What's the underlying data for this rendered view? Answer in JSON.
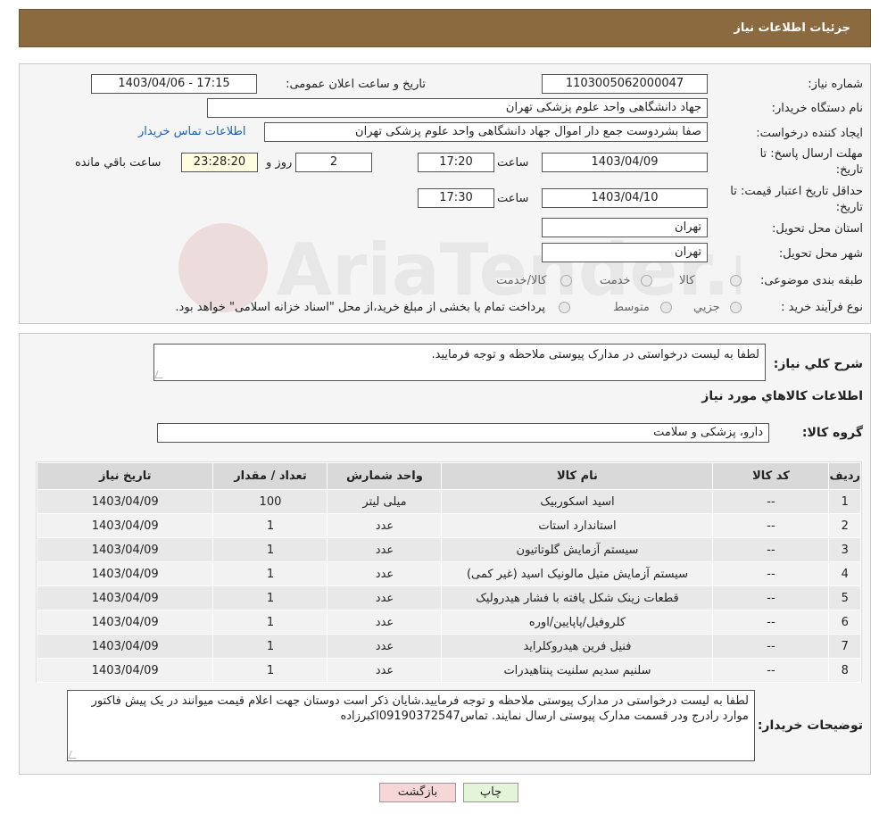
{
  "header": {
    "title": "جزئیات اطلاعات نیاز"
  },
  "form": {
    "need_number_label": "شماره نیاز:",
    "need_number": "1103005062000047",
    "announce_label": "تاریخ و ساعت اعلان عمومی:",
    "announce_value": "1403/04/06 - 17:15",
    "buyer_label": "نام دستگاه خریدار:",
    "buyer_value": "جهاد دانشگاهی واحد علوم پزشکی تهران",
    "creator_label": "ایجاد کننده درخواست:",
    "creator_value": "صفا بشردوست جمع دار اموال  جهاد دانشگاهی واحد علوم پزشکی تهران",
    "contact_link": "اطلاعات تماس خریدار",
    "deadline_label_1": "مهلت ارسال پاسخ: تا",
    "deadline_label_2": "تاریخ:",
    "deadline_date": "1403/04/09",
    "time_label": "ساعت",
    "deadline_time": "17:20",
    "days_value": "2",
    "days_label": "روز و",
    "remaining_value": "23:28:20",
    "remaining_label": "ساعت باقي مانده",
    "validity_label_1": "حداقل تاریخ اعتبار قیمت: تا",
    "validity_label_2": "تاریخ:",
    "validity_date": "1403/04/10",
    "validity_time_label": "ساعت",
    "validity_time": "17:30",
    "province_label": "استان محل تحویل:",
    "province_value": "تهران",
    "city_label": "شهر محل تحویل:",
    "city_value": "تهران",
    "category_label": "طبقه بندی موضوعی:",
    "category_options": [
      "کالا",
      "خدمت",
      "کالا/خدمت"
    ],
    "process_label": "نوع فرآیند خرید :",
    "process_options": [
      "جزيي",
      "متوسط"
    ],
    "process_note": "پرداخت تمام یا بخشی از مبلغ خرید،از محل \"اسناد خزانه اسلامی\" خواهد بود."
  },
  "description": {
    "label": "شرح کلي نياز:",
    "value": "لطفا به لیست درخواستی در مدارک پیوستی ملاحظه و توجه فرمایید."
  },
  "goods": {
    "section_title": "اطلاعات کالاهاي مورد نياز",
    "group_label": "گروه کالا:",
    "group_value": "دارو، پزشکی و سلامت",
    "columns": [
      "ردیف",
      "کد کالا",
      "نام کالا",
      "واحد شمارش",
      "تعداد / مقدار",
      "تاریخ نیاز"
    ],
    "rows": [
      [
        "1",
        "--",
        "اسید اسکوربیک",
        "میلی لیتر",
        "100",
        "1403/04/09"
      ],
      [
        "2",
        "--",
        "استاندارد استات",
        "عدد",
        "1",
        "1403/04/09"
      ],
      [
        "3",
        "--",
        "سیستم آزمایش گلوتاتیون",
        "عدد",
        "1",
        "1403/04/09"
      ],
      [
        "4",
        "--",
        "سیستم آزمایش متیل مالونیک اسید (غیر کمی)",
        "عدد",
        "1",
        "1403/04/09"
      ],
      [
        "5",
        "--",
        "قطعات زینک شکل یافته با فشار هیدرولیک",
        "عدد",
        "1",
        "1403/04/09"
      ],
      [
        "6",
        "--",
        "کلروفیل/پاپایین/اوره",
        "عدد",
        "1",
        "1403/04/09"
      ],
      [
        "7",
        "--",
        "فنیل فرین هیدروکلراید",
        "عدد",
        "1",
        "1403/04/09"
      ],
      [
        "8",
        "--",
        "سلنیم سدیم سلنیت پنتاهیدرات",
        "عدد",
        "1",
        "1403/04/09"
      ]
    ]
  },
  "buyer_notes": {
    "label": "توضیحات خریدار:",
    "value": "لطفا به لیست درخواستی در مدارک پیوستی ملاحظه و توجه فرمایید.شایان ذکر است دوستان جهت اعلام قیمت میوانند در یک پیش فاکتور موارد رادرج ودر قسمت مدارک پیوستی ارسال نمایند. تماس09190372547اکبرزاده"
  },
  "buttons": {
    "print": "چاپ",
    "back": "بازگشت"
  },
  "colors": {
    "header": "#8b6a3f",
    "link": "#1a5fb4",
    "back_btn": "#f6d6d6",
    "print_btn": "#e3f5d8"
  },
  "icons": {
    "watermark": "aria-tender-logo",
    "resize": "resize-grip-icon"
  }
}
